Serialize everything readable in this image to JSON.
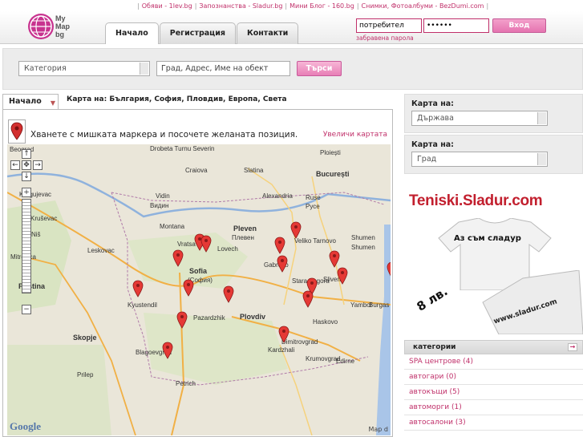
{
  "top_links": [
    "Обяви - 1lev.bg",
    "Запознанства - Sladur.bg",
    "Мини Блог - 160.bg",
    "Снимки, Фотоалбуми - BezDumi.com"
  ],
  "logo": {
    "text_line1": "My",
    "text_line2": "Map",
    "text_line3": "bg"
  },
  "tabs": [
    {
      "label": "Начало"
    },
    {
      "label": "Регистрация"
    },
    {
      "label": "Контакти"
    }
  ],
  "login": {
    "user_value": "потребител",
    "pass_value": "••••••",
    "button": "Вход",
    "forgot": "забравена парола"
  },
  "search": {
    "category": "Категория",
    "address": "Град, Адрес, Име на обект",
    "button": "Търси"
  },
  "map_tab": "Начало",
  "map_crumb_label": "Карта на:",
  "map_crumb_path": "България, София, Пловдив, Европа, Света",
  "map_hint": "Хванете с мишката маркера и посочете желаната позиция.",
  "map_enlarge": "Увеличи картата",
  "map_labels": [
    {
      "t": "Beograd"
    },
    {
      "t": "Drobeta Turnu Severin"
    },
    {
      "t": "Craiova"
    },
    {
      "t": "Slatina"
    },
    {
      "t": "Ploiești"
    },
    {
      "t": "București"
    },
    {
      "t": "Kragujevac"
    },
    {
      "t": "Vidin"
    },
    {
      "t": "Видин"
    },
    {
      "t": "Alexandria"
    },
    {
      "t": "Ruse"
    },
    {
      "t": "Русе"
    },
    {
      "t": "Kruševac"
    },
    {
      "t": "Montana"
    },
    {
      "t": "Pleven"
    },
    {
      "t": "Плевен"
    },
    {
      "t": "Niš"
    },
    {
      "t": "Leskovac"
    },
    {
      "t": "Vratsa"
    },
    {
      "t": "Lovech"
    },
    {
      "t": "Veliko Tarnovo"
    },
    {
      "t": "Shumen"
    },
    {
      "t": "Shumen"
    },
    {
      "t": "Mitrovica"
    },
    {
      "t": "Sofia"
    },
    {
      "t": "(София)"
    },
    {
      "t": "Gabrovo"
    },
    {
      "t": "Stara Zagora"
    },
    {
      "t": "Sliven"
    },
    {
      "t": "Yambol"
    },
    {
      "t": "Burgas"
    },
    {
      "t": "Priština"
    },
    {
      "t": "Kyustendil"
    },
    {
      "t": "Pazardzhik"
    },
    {
      "t": "Plovdiv"
    },
    {
      "t": "Haskovo"
    },
    {
      "t": "Skopje"
    },
    {
      "t": "Blagoevgrad"
    },
    {
      "t": "Kardzhali"
    },
    {
      "t": "Edirne"
    },
    {
      "t": "Prilep"
    },
    {
      "t": "Petrich"
    },
    {
      "t": "Krumovgrad"
    },
    {
      "t": "Dimitrovgrad"
    }
  ],
  "map_google": "Google",
  "map_data": "Map d",
  "right": {
    "label1": "Карта на:",
    "select1": "Държава",
    "label2": "Карта на:",
    "select2": "Град"
  },
  "ad": {
    "title": "Teniski.Sladur.com",
    "shirt_text": "Аз съм сладур",
    "price": "8 лв.",
    "url": "www.sladur.com"
  },
  "categories": {
    "title": "категории",
    "items": [
      {
        "label": "SPA центрове (4)"
      },
      {
        "label": "автогари (0)"
      },
      {
        "label": "автокъщи (5)"
      },
      {
        "label": "автоморги (1)"
      },
      {
        "label": "автосалони (3)"
      }
    ]
  },
  "colors": {
    "accent": "#c0306a",
    "button_pink": "#e87fb6",
    "brand": "#c8338f"
  },
  "icons": [
    "globe-logo-icon",
    "marker-icon",
    "pan-up-icon",
    "pan-left-icon",
    "pan-right-icon",
    "pan-down-icon",
    "zoom-in-icon",
    "zoom-out-icon",
    "dropdown-arrow-icon",
    "arrow-right-icon"
  ]
}
